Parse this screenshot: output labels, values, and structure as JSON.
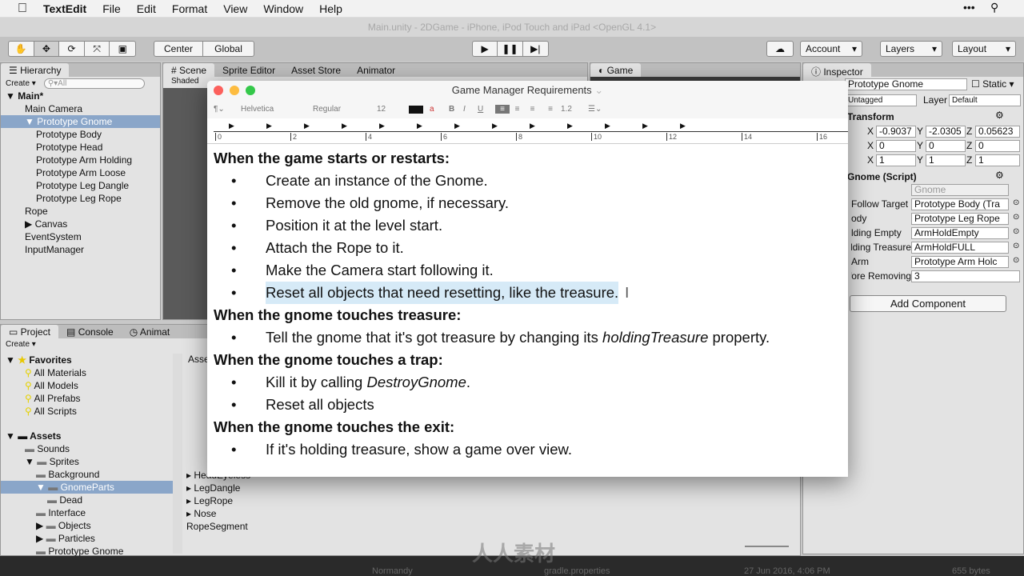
{
  "menubar": {
    "app": "TextEdit",
    "items": [
      "File",
      "Edit",
      "Format",
      "View",
      "Window",
      "Help"
    ]
  },
  "unity": {
    "title": "Main.unity - 2DGame - iPhone, iPod Touch and iPad <OpenGL 4.1>",
    "toolbar": {
      "pivot": "Center",
      "space": "Global",
      "account": "Account",
      "layers": "Layers",
      "layout": "Layout"
    },
    "hierarchy": {
      "tab": "Hierarchy",
      "create": "Create",
      "search_placeholder": "All",
      "scene": "Main*",
      "items": [
        {
          "label": "Main Camera",
          "indent": 1
        },
        {
          "label": "Prototype Gnome",
          "indent": 1,
          "selected": true
        },
        {
          "label": "Prototype Body",
          "indent": 2
        },
        {
          "label": "Prototype Head",
          "indent": 2
        },
        {
          "label": "Prototype Arm Holding",
          "indent": 2
        },
        {
          "label": "Prototype Arm Loose",
          "indent": 2
        },
        {
          "label": "Prototype Leg Dangle",
          "indent": 2
        },
        {
          "label": "Prototype Leg Rope",
          "indent": 2
        },
        {
          "label": "Rope",
          "indent": 1
        },
        {
          "label": "Canvas",
          "indent": 1
        },
        {
          "label": "EventSystem",
          "indent": 1
        },
        {
          "label": "InputManager",
          "indent": 1
        }
      ]
    },
    "scene_tabs": [
      "Scene",
      "Sprite Editor",
      "Asset Store",
      "Animator"
    ],
    "scene_shading": "Shaded",
    "game_tab": "Game",
    "inspector": {
      "tab": "Inspector",
      "name": "Prototype Gnome",
      "static": "Static",
      "tag": "Untagged",
      "layer_label": "Layer",
      "layer": "Default",
      "transform": {
        "title": "Transform",
        "position": [
          "-0.9037",
          "-2.0305",
          "0.05623"
        ],
        "rotation": [
          "0",
          "0",
          "0"
        ],
        "scale": [
          "1",
          "1",
          "1"
        ]
      },
      "script": {
        "title": "Gnome (Script)",
        "script_value": "Gnome",
        "fields": [
          {
            "label": "Follow Target",
            "value": "Prototype Body (Tra"
          },
          {
            "label": "ody",
            "value": "Prototype Leg Rope"
          },
          {
            "label": "lding Empty",
            "value": "ArmHoldEmpty"
          },
          {
            "label": "lding Treasure",
            "value": "ArmHoldFULL"
          },
          {
            "label": "Arm",
            "value": "Prototype Arm Holc"
          },
          {
            "label": "efore Removing",
            "value": "3"
          }
        ]
      },
      "add_component": "Add Component"
    },
    "project": {
      "tabs": [
        "Project",
        "Console",
        "Animat"
      ],
      "create": "Create",
      "favorites": {
        "label": "Favorites",
        "items": [
          "All Materials",
          "All Models",
          "All Prefabs",
          "All Scripts"
        ]
      },
      "assets": {
        "label": "Assets",
        "items": [
          {
            "label": "Sounds",
            "indent": 1
          },
          {
            "label": "Sprites",
            "indent": 1
          },
          {
            "label": "Background",
            "indent": 2
          },
          {
            "label": "GnomeParts",
            "indent": 2,
            "selected": true
          },
          {
            "label": "Dead",
            "indent": 3
          },
          {
            "label": "Interface",
            "indent": 2
          },
          {
            "label": "Objects",
            "indent": 2
          },
          {
            "label": "Particles",
            "indent": 2
          },
          {
            "label": "Prototype Gnome",
            "indent": 2
          }
        ]
      },
      "breadcrumb": "Asse",
      "files": [
        "HeadEyeless",
        "LegDangle",
        "LegRope",
        "Nose",
        "RopeSegment"
      ]
    }
  },
  "textedit": {
    "title": "Game Manager Requirements",
    "font": "Helvetica",
    "style": "Regular",
    "size": "12",
    "spacing": "1.2",
    "ruler_labels": [
      "0",
      "2",
      "4",
      "6",
      "8",
      "10",
      "12",
      "14",
      "16"
    ],
    "content": [
      {
        "type": "h",
        "text": "When the game starts or restarts:"
      },
      {
        "type": "b",
        "text": "Create an instance of the Gnome."
      },
      {
        "type": "b",
        "text": "Remove the old gnome, if necessary."
      },
      {
        "type": "b",
        "text": "Position it at the level start."
      },
      {
        "type": "b",
        "text": "Attach the Rope to it."
      },
      {
        "type": "b",
        "text": "Make the Camera start following it."
      },
      {
        "type": "b",
        "text": "Reset all objects that need resetting, like the treasure.",
        "highlight": true
      },
      {
        "type": "h",
        "text": "When the gnome touches treasure:"
      },
      {
        "type": "b",
        "pre": "Tell the gnome that it's got treasure by changing its ",
        "em": "holdingTreasure",
        "post": " property."
      },
      {
        "type": "h",
        "text": "When the gnome touches a trap:"
      },
      {
        "type": "b",
        "pre": "Kill it by calling ",
        "em": "DestroyGnome",
        "post": "."
      },
      {
        "type": "b",
        "text": "Reset all objects"
      },
      {
        "type": "h",
        "text": "When the gnome touches the exit:"
      },
      {
        "type": "b",
        "text": "If it's holding treasure, show a game over view."
      }
    ]
  },
  "background_finder": {
    "items": [
      "Normandy",
      "gradle.properties",
      "27 Jun 2016, 4:06 PM",
      "655 bytes"
    ]
  },
  "watermark": "人人素材"
}
